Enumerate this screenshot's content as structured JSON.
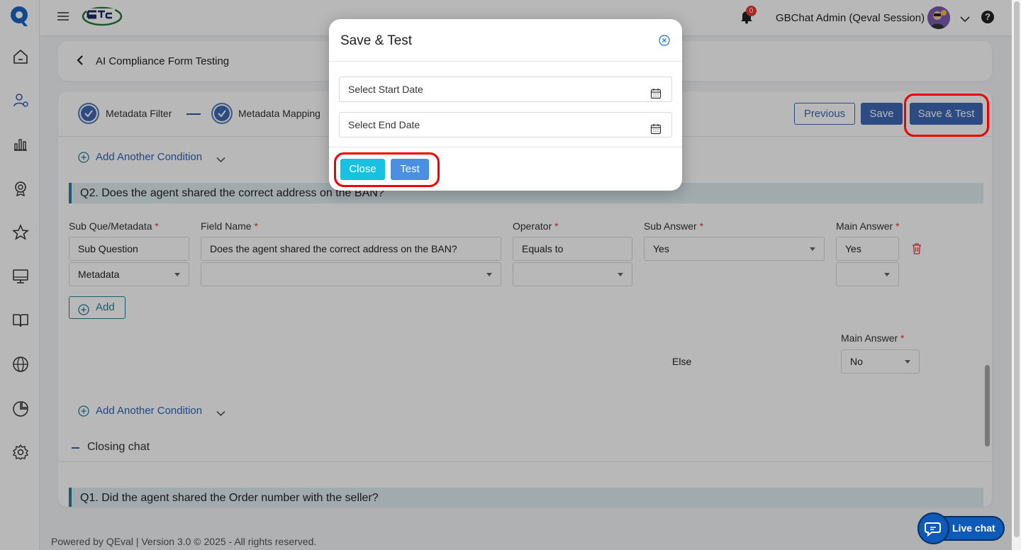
{
  "header": {
    "user_name": "GBChat Admin (Qeval Session)",
    "notification_count": "0",
    "help_glyph": "?"
  },
  "page": {
    "title": "AI Compliance Form Testing"
  },
  "stepper": {
    "steps": [
      {
        "label": "Metadata Filter"
      },
      {
        "label": "Metadata Mapping"
      }
    ],
    "previous_label": "Previous",
    "save_label": "Save",
    "save_test_label": "Save & Test"
  },
  "conditions": {
    "add_another_label": "Add Another Condition",
    "question": "Q2. Does the agent shared the correct address on the BAN?",
    "labels": {
      "sub_que": "Sub Que/Metadata",
      "field_name": "Field Name",
      "operator": "Operator",
      "sub_answer": "Sub Answer",
      "main_answer": "Main Answer",
      "required_mark": "*"
    },
    "row": {
      "sub_que": "Sub Question",
      "field_name": "Does the agent shared the correct address on the BAN?",
      "operator": "Equals to",
      "sub_answer": "Yes",
      "main_answer": "Yes",
      "metadata": "Metadata"
    },
    "add_label": "Add",
    "else_label": "Else",
    "else_main_answer_label": "Main Answer",
    "else_main_answer": "No"
  },
  "section": {
    "closing_label": "Closing chat",
    "next_question": "Q1. Did the agent shared the Order number with the seller?"
  },
  "footer": {
    "text": "Powered by QEval | Version 3.0 © 2025 - All rights reserved."
  },
  "modal": {
    "title": "Save & Test",
    "start_placeholder": "Select Start Date",
    "end_placeholder": "Select End Date",
    "close_label": "Close",
    "test_label": "Test"
  },
  "livechat": {
    "label": "Live chat"
  },
  "colors": {
    "primary": "#3d68b5",
    "accent_teal": "#2a7d9a",
    "highlight": "#e00000",
    "close_button": "#19c1e0",
    "test_button": "#4a90e2"
  }
}
